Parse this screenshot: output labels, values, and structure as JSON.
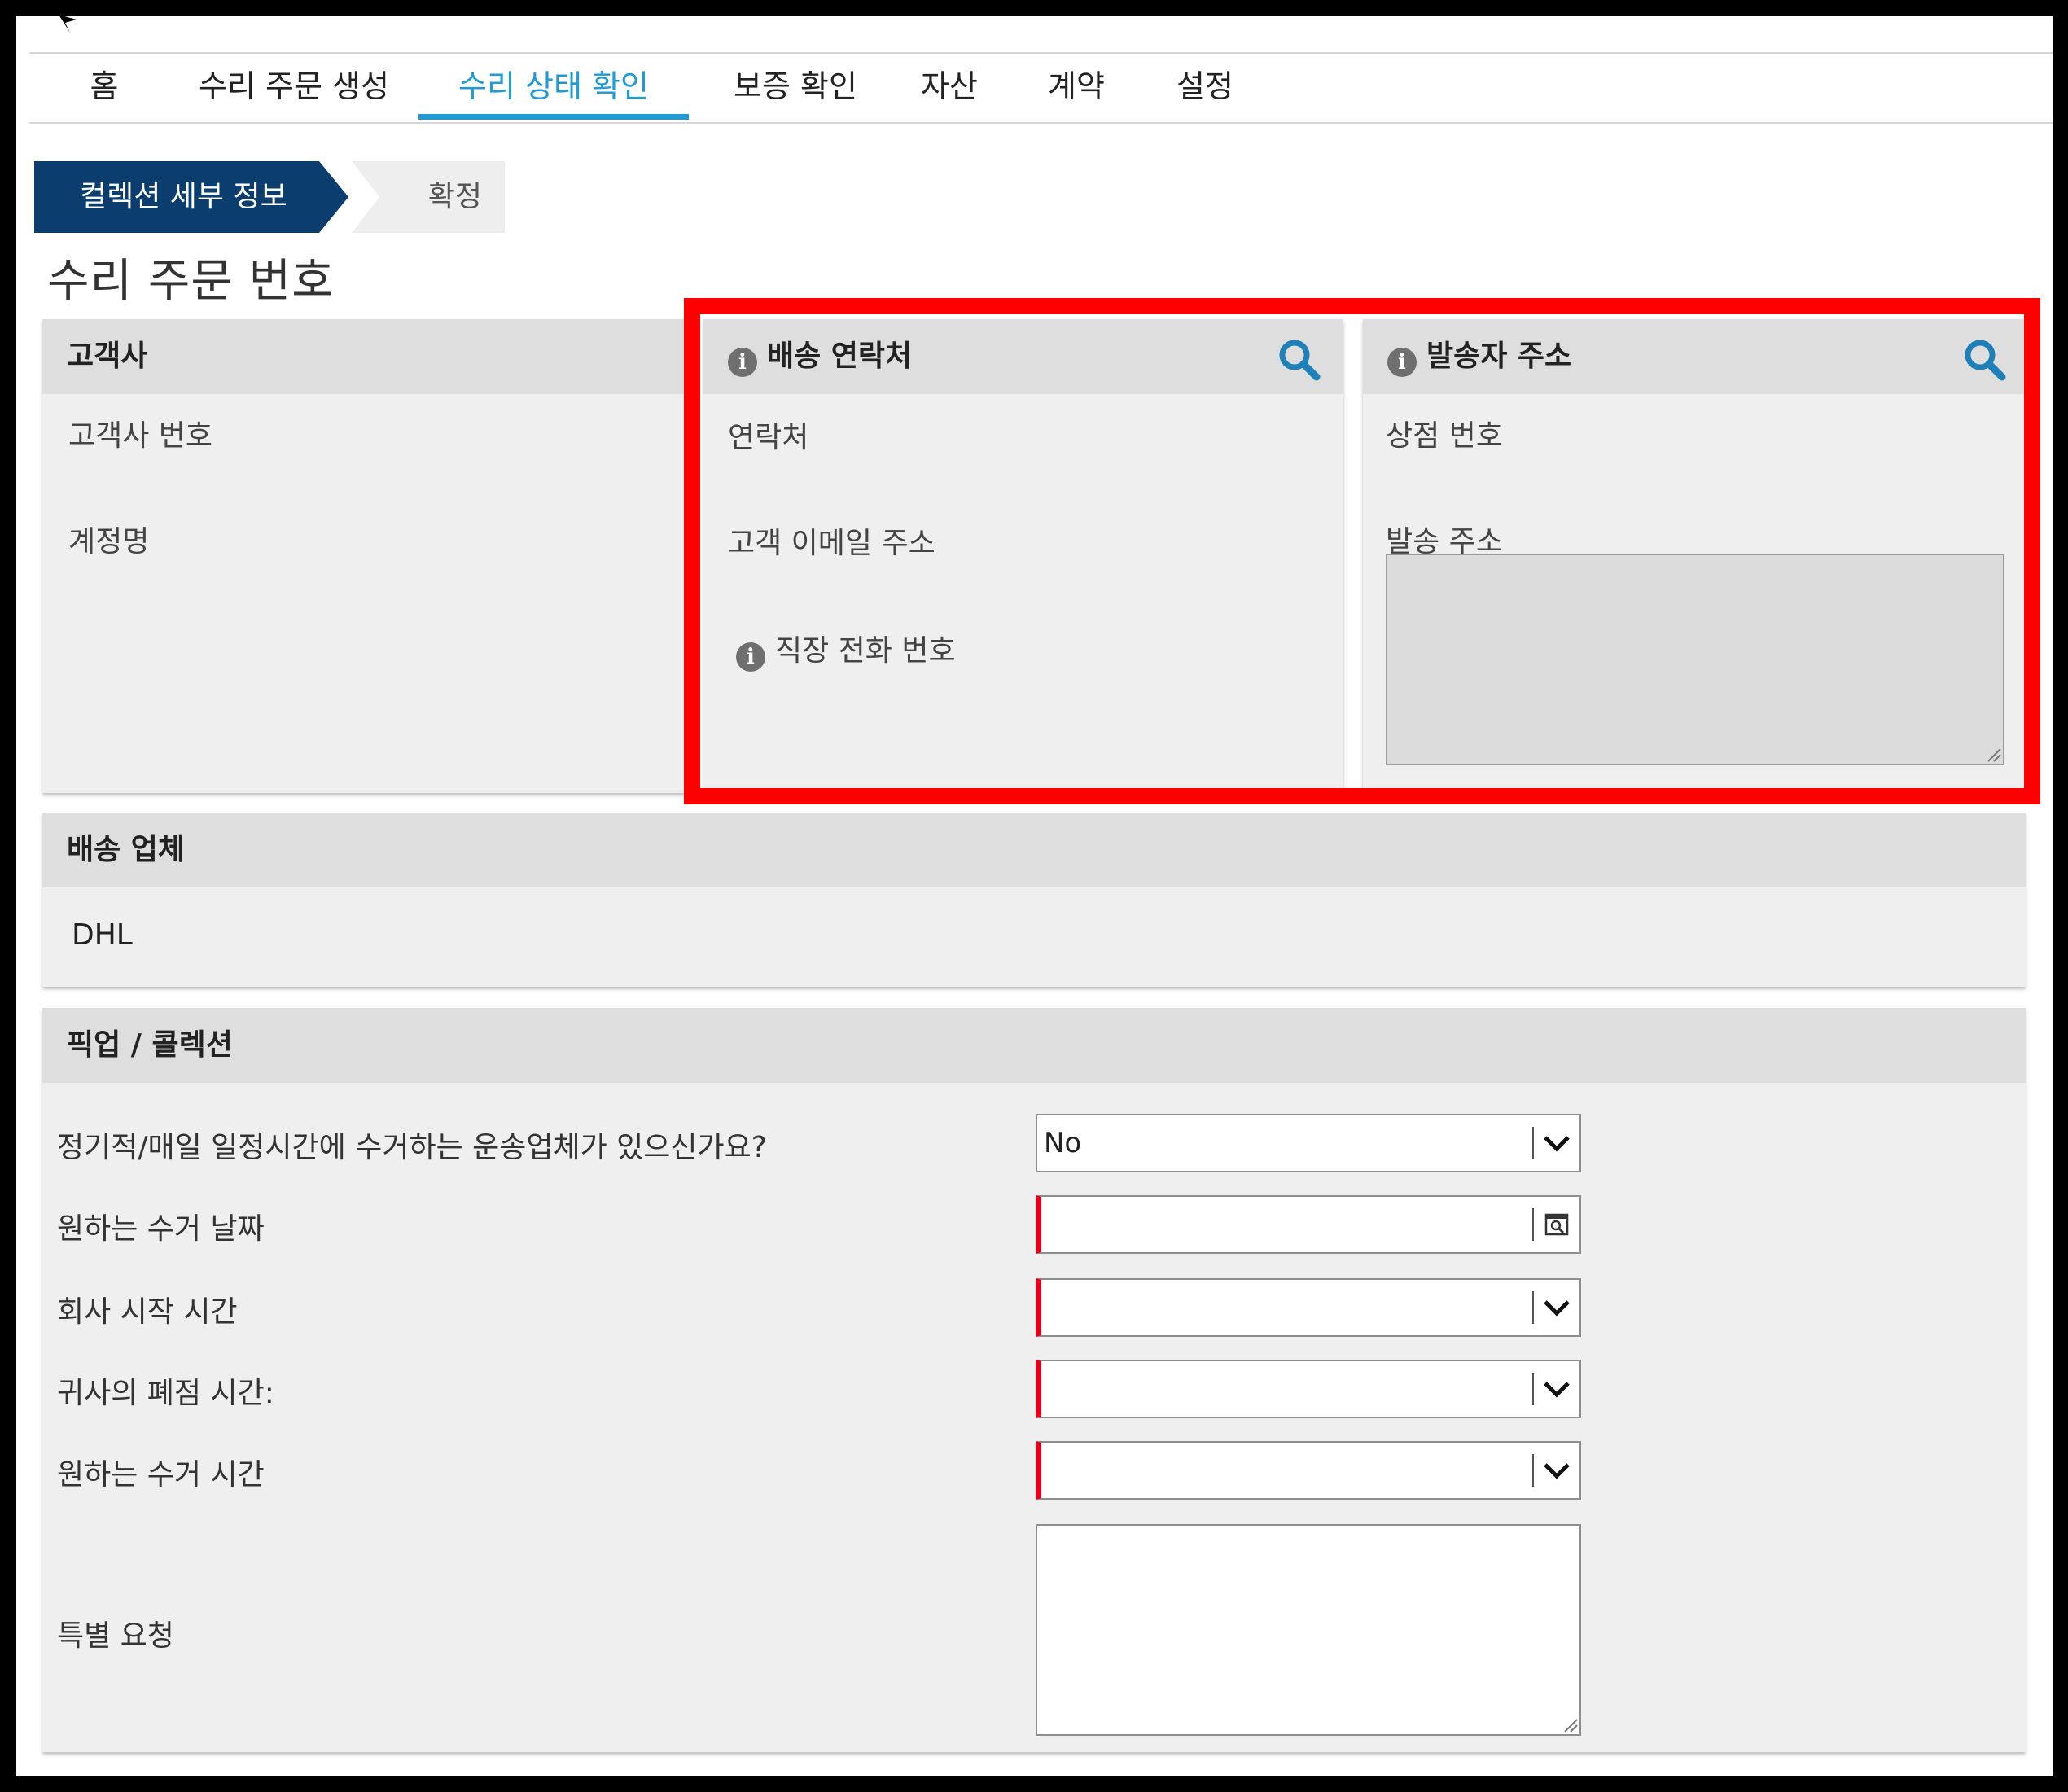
{
  "nav": {
    "tabs": [
      {
        "label": "홈"
      },
      {
        "label": "수리 주문 생성"
      },
      {
        "label": "수리 상태 확인",
        "active": true
      },
      {
        "label": "보증 확인"
      },
      {
        "label": "자산"
      },
      {
        "label": "계약"
      },
      {
        "label": "설정"
      }
    ]
  },
  "steps": {
    "current": "컬렉션 세부 정보",
    "next": "확정"
  },
  "page": {
    "title": "수리 주문 번호"
  },
  "customer": {
    "title": "고객사",
    "fields": [
      "고객사 번호",
      "계정명"
    ]
  },
  "shipping_contact": {
    "title": "배송 연락처",
    "fields": [
      "연락처",
      "고객 이메일 주소",
      "직장 전화 번호"
    ]
  },
  "sender_address": {
    "title": "발송자 주소",
    "fields": [
      "상점 번호",
      "발송 주소"
    ]
  },
  "carrier": {
    "title": "배송 업체",
    "value": "DHL"
  },
  "pickup": {
    "title": "픽업 / 콜렉션",
    "fields": [
      {
        "label": "정기적/매일 일정시간에 수거하는 운송업체가 있으신가요?",
        "value": "No"
      },
      {
        "label": "원하는 수거 날짜",
        "value": ""
      },
      {
        "label": "회사 시작 시간",
        "value": ""
      },
      {
        "label": "귀사의 폐점 시간:",
        "value": ""
      },
      {
        "label": "원하는 수거 시간",
        "value": ""
      },
      {
        "label": "특별 요청",
        "value": ""
      }
    ]
  },
  "colors": {
    "accent": "#1f9bd7",
    "step_active": "#0b3d6f",
    "required": "#e3001b",
    "highlight": "#ff0000",
    "search_icon": "#1f80b8"
  },
  "icons": {
    "info": "info-circle-icon",
    "search": "search-icon",
    "dropdown": "chevron-down-icon",
    "calendar": "calendar-icon"
  }
}
